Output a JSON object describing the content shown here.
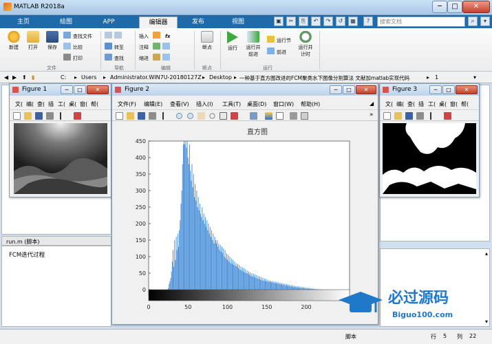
{
  "window": {
    "title": "MATLAB R2018a",
    "min": "─",
    "max": "□",
    "close": "✕"
  },
  "tabs": [
    "主页",
    "绘图",
    "APP",
    "编辑器",
    "发布",
    "视图"
  ],
  "active_tab": "编辑器",
  "quick_access": [
    "▣",
    "✂",
    "⎘",
    "↶",
    "↷",
    "↺",
    "▦",
    "?"
  ],
  "search": {
    "placeholder": "搜索文档"
  },
  "ribbon": {
    "file": {
      "new": "新建",
      "open": "打开",
      "save": "保存",
      "find_files": "查找文件",
      "compare": "比较",
      "print": "打印",
      "group": "文件"
    },
    "nav": {
      "goto": "转至",
      "find": "查找",
      "group": "导航"
    },
    "edit": {
      "insert": "插入",
      "comment": "注释",
      "indent": "缩进",
      "fx": "fx",
      "group": "编辑"
    },
    "breakpoints": {
      "bp": "断点",
      "group": "断点"
    },
    "run": {
      "run": "运行",
      "run_advance": "运行并\n前进",
      "run_section": "运行节",
      "advance": "前进",
      "run_time": "运行并\n计时",
      "group": "运行"
    }
  },
  "path": {
    "segments": [
      "C:",
      "Users",
      "Administrator.WIN7U-20180127Z",
      "Desktop",
      "一种基于直方图改进的FCM聚类水下图像分割算法 文献加matlab实现代码",
      "1"
    ]
  },
  "editor": {
    "filename": "run.m  (脚本)",
    "text": "FCM迭代过程"
  },
  "status": {
    "mode": "脚本",
    "row_label": "行",
    "row": "5",
    "col_label": "列",
    "col": "22"
  },
  "figure_toolbar": [
    "▭",
    "📂",
    "💾",
    "🖨",
    "⬉",
    "✎"
  ],
  "figure1": {
    "title": "Figure 1",
    "menu": [
      "文(",
      "编(",
      "查(",
      "插",
      "工(",
      "桌(",
      "窗(",
      "帮("
    ]
  },
  "figure2": {
    "title": "Figure 2",
    "menu": [
      "文件(F)",
      "编辑(E)",
      "查看(V)",
      "插入(I)",
      "工具(T)",
      "桌面(D)",
      "窗口(W)",
      "帮助(H)"
    ],
    "expand": "»"
  },
  "figure3": {
    "title": "Figure 3",
    "menu": [
      "文(",
      "编(",
      "查(",
      "插",
      "工(",
      "桌(",
      "窗(",
      "帮("
    ]
  },
  "watermark": {
    "name": "必过源码",
    "url": "Biguo100.com"
  },
  "chart_data": {
    "type": "bar",
    "title": "直方图",
    "xlabel": "",
    "ylabel": "",
    "xlim": [
      0,
      255
    ],
    "ylim": [
      0,
      450
    ],
    "xticks": [
      0,
      50,
      100,
      150,
      200
    ],
    "yticks": [
      0,
      50,
      100,
      150,
      200,
      250,
      300,
      350,
      400,
      450
    ],
    "bar_color": "#4a90d9",
    "grayscale_colorbar": true,
    "x": [
      0,
      1,
      2,
      3,
      4,
      5,
      6,
      7,
      8,
      9,
      10,
      11,
      12,
      13,
      14,
      15,
      16,
      17,
      18,
      19,
      20,
      21,
      22,
      23,
      24,
      25,
      26,
      27,
      28,
      29,
      30,
      31,
      32,
      33,
      34,
      35,
      36,
      37,
      38,
      39,
      40,
      41,
      42,
      43,
      44,
      45,
      46,
      47,
      48,
      49,
      50,
      51,
      52,
      53,
      54,
      55,
      56,
      57,
      58,
      59,
      60,
      61,
      62,
      63,
      64,
      65,
      66,
      67,
      68,
      69,
      70,
      71,
      72,
      73,
      74,
      75,
      76,
      77,
      78,
      79,
      80,
      81,
      82,
      83,
      84,
      85,
      86,
      87,
      88,
      89,
      90,
      91,
      92,
      93,
      94,
      95,
      96,
      97,
      98,
      99,
      100,
      101,
      102,
      103,
      104,
      105,
      106,
      107,
      108,
      109,
      110,
      111,
      112,
      113,
      114,
      115,
      116,
      117,
      118,
      119,
      120,
      121,
      122,
      123,
      124,
      125,
      126,
      127,
      128,
      129,
      130,
      131,
      132,
      133,
      134,
      135,
      136,
      137,
      138,
      139,
      140,
      141,
      142,
      143,
      144,
      145,
      146,
      147,
      148,
      149,
      150,
      151,
      152,
      153,
      154,
      155,
      156,
      157,
      158,
      159,
      160,
      161,
      162,
      163,
      164,
      165,
      166,
      167,
      168,
      169,
      170,
      171,
      172,
      173,
      174,
      175,
      176,
      177,
      178,
      179,
      180,
      181,
      182,
      183,
      184,
      185,
      186,
      187,
      188,
      189,
      190,
      191,
      192,
      193,
      194,
      195,
      196,
      197,
      198,
      199,
      200,
      201,
      202,
      203,
      204,
      205,
      206,
      207,
      208,
      209,
      210,
      211,
      212,
      213,
      214,
      215,
      216,
      217,
      218,
      219,
      220,
      221,
      222,
      223,
      224,
      225,
      226,
      227,
      228,
      229,
      230,
      231,
      232,
      233,
      234,
      235,
      236,
      237,
      238,
      239,
      240,
      241,
      242,
      243,
      244,
      245,
      246,
      247,
      248,
      249,
      250,
      251,
      252,
      253,
      254,
      255
    ],
    "values": [
      0,
      0,
      0,
      0,
      0,
      0,
      0,
      0,
      0,
      0,
      0,
      0,
      0,
      0,
      0,
      0,
      0,
      0,
      0,
      0,
      0,
      0,
      0,
      0,
      0,
      5,
      18,
      25,
      35,
      55,
      85,
      120,
      70,
      150,
      90,
      160,
      120,
      170,
      130,
      180,
      210,
      260,
      300,
      380,
      440,
      460,
      440,
      460,
      430,
      450,
      400,
      380,
      440,
      360,
      330,
      380,
      310,
      350,
      280,
      320,
      270,
      300,
      250,
      280,
      240,
      260,
      230,
      220,
      250,
      210,
      230,
      200,
      220,
      190,
      210,
      180,
      200,
      170,
      190,
      160,
      180,
      150,
      170,
      140,
      160,
      150,
      140,
      150,
      130,
      140,
      120,
      135,
      115,
      130,
      110,
      125,
      100,
      120,
      95,
      110,
      90,
      105,
      85,
      100,
      80,
      95,
      78,
      90,
      75,
      85,
      72,
      80,
      70,
      78,
      65,
      75,
      60,
      70,
      58,
      68,
      55,
      65,
      52,
      62,
      50,
      58,
      48,
      55,
      45,
      52,
      42,
      50,
      40,
      48,
      38,
      46,
      36,
      44,
      34,
      42,
      32,
      40,
      30,
      38,
      28,
      36,
      27,
      34,
      26,
      32,
      25,
      30,
      24,
      28,
      23,
      27,
      22,
      26,
      21,
      25,
      20,
      24,
      19,
      23,
      18,
      22,
      17,
      21,
      16,
      20,
      15,
      19,
      14,
      18,
      13,
      17,
      12,
      16,
      11,
      15,
      10,
      14,
      9,
      13,
      8,
      12,
      8,
      11,
      7,
      10,
      6,
      10,
      5,
      9,
      5,
      8,
      4,
      8,
      4,
      7,
      3,
      6,
      3,
      5,
      2,
      5,
      2,
      4,
      2,
      3,
      1,
      3,
      1,
      2,
      1,
      2,
      0,
      1,
      0,
      1,
      0,
      0,
      0,
      0,
      0,
      0,
      0,
      0,
      0,
      0,
      0,
      0,
      0,
      0,
      0,
      0,
      0,
      0,
      0,
      0,
      0,
      0,
      0,
      0,
      0,
      0,
      0,
      0,
      0,
      0,
      0,
      0,
      0,
      0,
      0,
      0,
      0,
      0,
      0,
      0,
      0,
      0,
      0,
      0,
      0,
      0,
      0,
      0,
      0
    ]
  }
}
